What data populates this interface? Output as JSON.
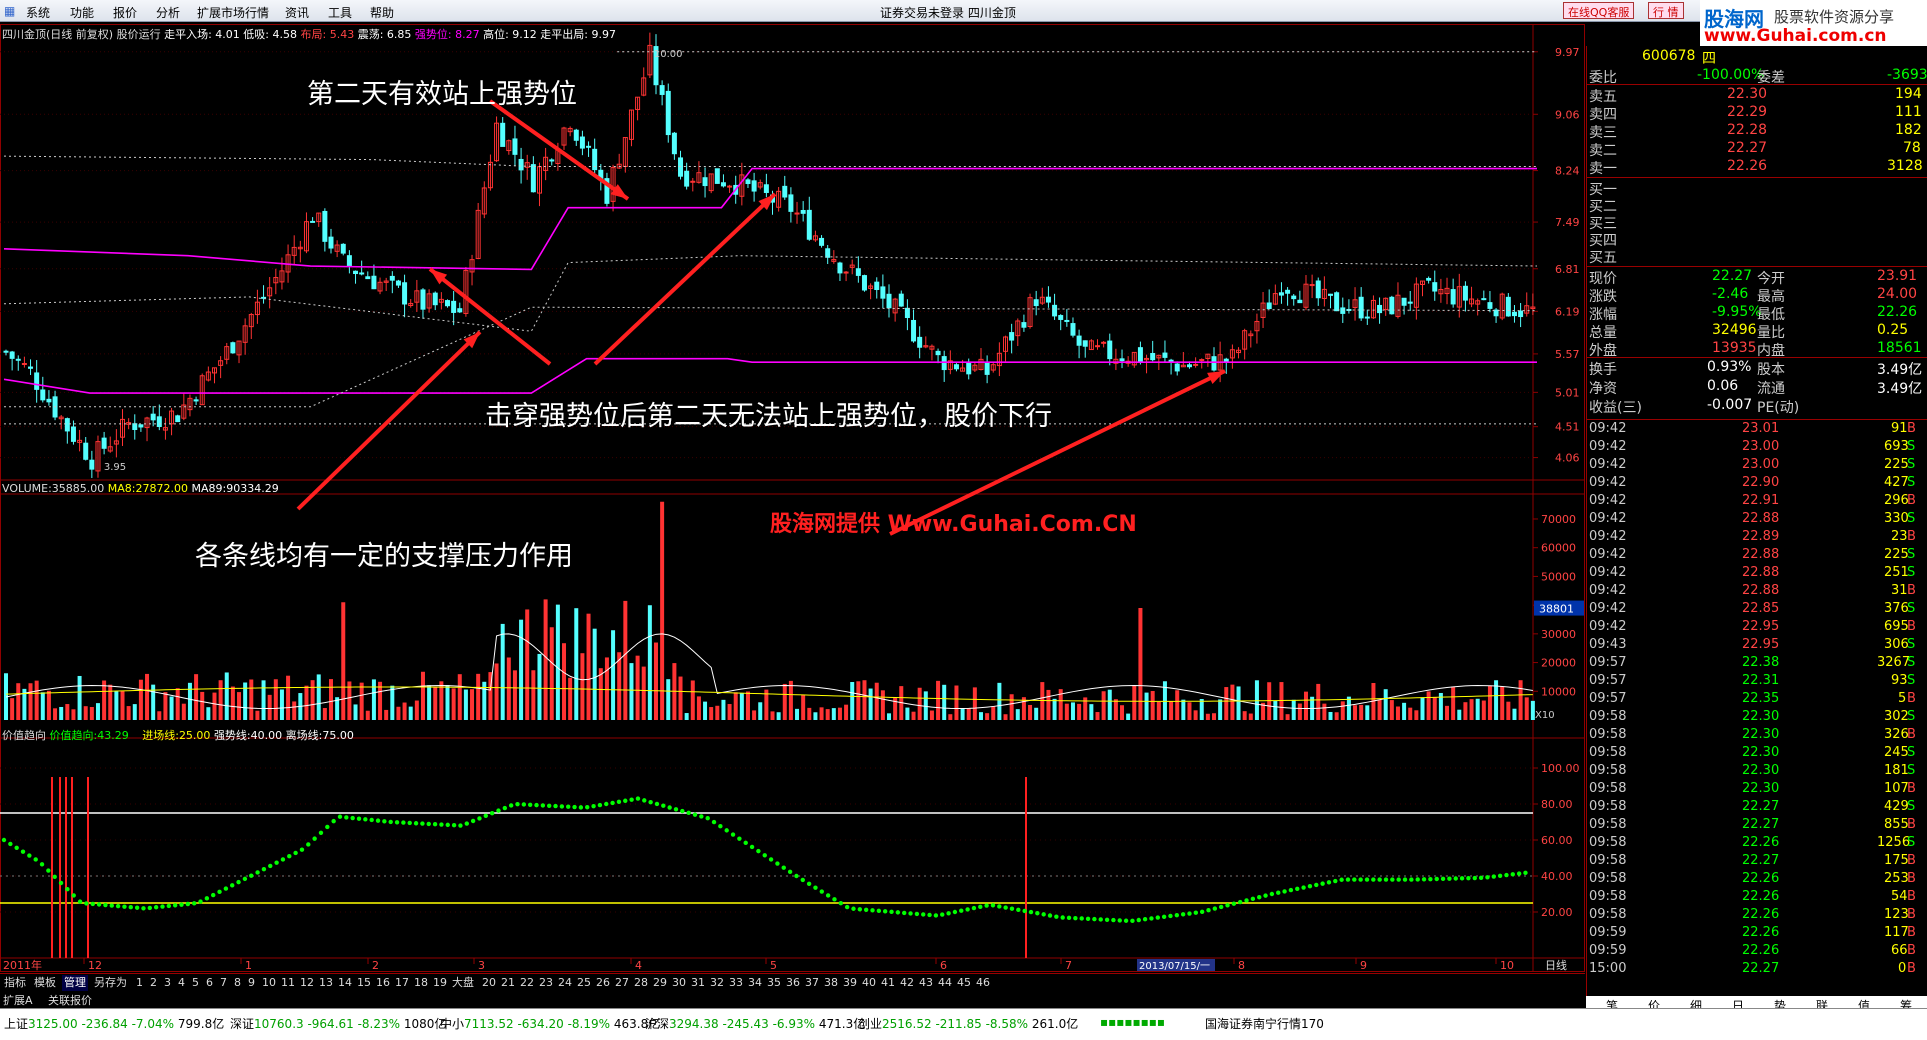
{
  "window": {
    "title": "证券交易未登录   四川金顶",
    "menu": [
      "系统",
      "功能",
      "报价",
      "分析",
      "扩展市场行情",
      "资讯",
      "工具",
      "帮助"
    ],
    "qq_service": "在线QQ客服",
    "market_btn": "行 情",
    "win_buttons": [
      "_",
      "□",
      "×"
    ]
  },
  "logo": {
    "line1_a": "股海网",
    "line1_b": "股票软件资源分享",
    "line2": "www.Guhai.com.cn"
  },
  "chart": {
    "header": {
      "title": "四川金顶(日线 前复权)",
      "indicator": "股价运行",
      "items": [
        {
          "label": "走平入场:",
          "value": "4.01",
          "color": "#ffffff"
        },
        {
          "label": "低吸:",
          "value": "4.58",
          "color": "#ffffff"
        },
        {
          "label": "布局:",
          "value": "5.43",
          "color": "#ff4444"
        },
        {
          "label": "震荡:",
          "value": "6.85",
          "color": "#ffffff"
        },
        {
          "label": "强势位:",
          "value": "8.27",
          "color": "#ff00ff"
        },
        {
          "label": "高位:",
          "value": "9.12",
          "color": "#ffffff"
        },
        {
          "label": "走平出局:",
          "value": "9.97",
          "color": "#ffffff"
        }
      ]
    },
    "price_axis": [
      "9.97",
      "9.06",
      "8.24",
      "7.49",
      "6.81",
      "6.19",
      "5.57",
      "5.01",
      "4.51",
      "4.06"
    ],
    "max_label": "10.00",
    "min_label": "3.95",
    "annotations": {
      "a1": "第二天有效站上强势位",
      "a2": "击穿强势位后第二天无法站上强势位，股价下行",
      "a3": "各条线均有一定的支撑压力作用",
      "watermark": "股海网提供 Www.Guhai.Com.CN"
    },
    "volume": {
      "header": {
        "label": "VOLUME:",
        "value": "35885.00",
        "ma8_label": "MA8:",
        "ma8": "27872.00",
        "ma89_label": "MA89:",
        "ma89": "90334.29"
      },
      "axis": [
        "70000",
        "60000",
        "50000",
        "40000",
        "30000",
        "20000",
        "10000"
      ],
      "current_tag": "38801",
      "unit": "X10"
    },
    "indicator": {
      "header": {
        "name": "价值趋向",
        "l1": "价值趋向:",
        "v1": "43.29",
        "l2": "进场线:",
        "v2": "25.00",
        "l3": "强势线:",
        "v3": "40.00",
        "l4": "离场线:",
        "v4": "75.00"
      },
      "axis": [
        "100.00",
        "80.00",
        "60.00",
        "40.00",
        "20.00"
      ]
    },
    "time_axis": {
      "start": "2011年",
      "ticks": [
        "12",
        "1",
        "2",
        "3",
        "4",
        "5",
        "6",
        "7",
        "8",
        "9",
        "10"
      ],
      "cursor_date": "2013/07/15/一",
      "period": "日线"
    }
  },
  "tabbar": {
    "tabs": [
      "指标",
      "模板",
      "管理",
      "另存为",
      "1",
      "2",
      "3",
      "4",
      "5",
      "6",
      "7",
      "8",
      "9",
      "10",
      "11",
      "12",
      "13",
      "14",
      "15",
      "16",
      "17",
      "18",
      "19",
      "大盘",
      "20",
      "21",
      "22",
      "23",
      "24",
      "25",
      "26",
      "27",
      "28",
      "29",
      "30",
      "31",
      "32",
      "33",
      "34",
      "35",
      "36",
      "37",
      "38",
      "39",
      "40",
      "41",
      "42",
      "43",
      "44",
      "45",
      "46"
    ],
    "tabs2": [
      "扩展A",
      "关联报价"
    ]
  },
  "panel": {
    "code": "600678",
    "name_part": "四",
    "weibi": {
      "label": "委比",
      "value": "-100.00%",
      "label2": "委差",
      "value2": "-3693"
    },
    "asks": [
      {
        "label": "卖五",
        "price": "22.30",
        "vol": "194"
      },
      {
        "label": "卖四",
        "price": "22.29",
        "vol": "111"
      },
      {
        "label": "卖三",
        "price": "22.28",
        "vol": "182"
      },
      {
        "label": "卖二",
        "price": "22.27",
        "vol": "78"
      },
      {
        "label": "卖一",
        "price": "22.26",
        "vol": "3128"
      }
    ],
    "bids": [
      {
        "label": "买一",
        "price": "",
        "vol": ""
      },
      {
        "label": "买二",
        "price": "",
        "vol": ""
      },
      {
        "label": "买三",
        "price": "",
        "vol": ""
      },
      {
        "label": "买四",
        "price": "",
        "vol": ""
      },
      {
        "label": "买五",
        "price": "",
        "vol": ""
      }
    ],
    "quote": [
      {
        "l1": "现价",
        "v1": "22.27",
        "c1": "#00ff00",
        "l2": "今开",
        "v2": "23.91",
        "c2": "#ff4444"
      },
      {
        "l1": "涨跌",
        "v1": "-2.46",
        "c1": "#00ff00",
        "l2": "最高",
        "v2": "24.00",
        "c2": "#ff4444"
      },
      {
        "l1": "涨幅",
        "v1": "-9.95%",
        "c1": "#00ff00",
        "l2": "最低",
        "v2": "22.26",
        "c2": "#00ff00"
      },
      {
        "l1": "总量",
        "v1": "32496",
        "c1": "#ffff00",
        "l2": "量比",
        "v2": "0.25",
        "c2": "#ffff00"
      },
      {
        "l1": "外盘",
        "v1": "13935",
        "c1": "#ff4444",
        "l2": "内盘",
        "v2": "18561",
        "c2": "#00ff00"
      }
    ],
    "stats": [
      {
        "l1": "换手",
        "v1": "0.93%",
        "l2": "股本",
        "v2": "3.49亿"
      },
      {
        "l1": "净资",
        "v1": "0.06",
        "l2": "流通",
        "v2": "3.49亿"
      },
      {
        "l1": "收益(三)",
        "v1": "-0.007",
        "l2": "PE(动)",
        "v2": ""
      }
    ],
    "ticks": [
      {
        "t": "09:42",
        "p": "23.01",
        "v": "91",
        "d": "B"
      },
      {
        "t": "09:42",
        "p": "23.00",
        "v": "693",
        "d": "S"
      },
      {
        "t": "09:42",
        "p": "23.00",
        "v": "225",
        "d": "S"
      },
      {
        "t": "09:42",
        "p": "22.90",
        "v": "427",
        "d": "S"
      },
      {
        "t": "09:42",
        "p": "22.91",
        "v": "296",
        "d": "B"
      },
      {
        "t": "09:42",
        "p": "22.88",
        "v": "330",
        "d": "S"
      },
      {
        "t": "09:42",
        "p": "22.89",
        "v": "23",
        "d": "B"
      },
      {
        "t": "09:42",
        "p": "22.88",
        "v": "225",
        "d": "S"
      },
      {
        "t": "09:42",
        "p": "22.88",
        "v": "251",
        "d": "S"
      },
      {
        "t": "09:42",
        "p": "22.88",
        "v": "31",
        "d": "B"
      },
      {
        "t": "09:42",
        "p": "22.85",
        "v": "376",
        "d": "S"
      },
      {
        "t": "09:42",
        "p": "22.95",
        "v": "695",
        "d": "B"
      },
      {
        "t": "09:43",
        "p": "22.95",
        "v": "306",
        "d": "S"
      },
      {
        "t": "09:57",
        "p": "22.38",
        "v": "3267",
        "d": "S"
      },
      {
        "t": "09:57",
        "p": "22.31",
        "v": "93",
        "d": "S"
      },
      {
        "t": "09:57",
        "p": "22.35",
        "v": "5",
        "d": "B"
      },
      {
        "t": "09:58",
        "p": "22.30",
        "v": "302",
        "d": "S"
      },
      {
        "t": "09:58",
        "p": "22.30",
        "v": "326",
        "d": "B"
      },
      {
        "t": "09:58",
        "p": "22.30",
        "v": "245",
        "d": "S"
      },
      {
        "t": "09:58",
        "p": "22.30",
        "v": "181",
        "d": "S"
      },
      {
        "t": "09:58",
        "p": "22.30",
        "v": "107",
        "d": "B"
      },
      {
        "t": "09:58",
        "p": "22.27",
        "v": "429",
        "d": "S"
      },
      {
        "t": "09:58",
        "p": "22.27",
        "v": "855",
        "d": "B"
      },
      {
        "t": "09:58",
        "p": "22.26",
        "v": "1256",
        "d": "S"
      },
      {
        "t": "09:58",
        "p": "22.27",
        "v": "175",
        "d": "B"
      },
      {
        "t": "09:58",
        "p": "22.26",
        "v": "253",
        "d": "B"
      },
      {
        "t": "09:58",
        "p": "22.26",
        "v": "54",
        "d": "B"
      },
      {
        "t": "09:58",
        "p": "22.26",
        "v": "123",
        "d": "B"
      },
      {
        "t": "09:59",
        "p": "22.26",
        "v": "117",
        "d": "B"
      },
      {
        "t": "09:59",
        "p": "22.26",
        "v": "66",
        "d": "B"
      },
      {
        "t": "15:00",
        "p": "22.27",
        "v": "0",
        "d": "B"
      }
    ],
    "tabs": [
      "笔",
      "价",
      "细",
      "日",
      "势",
      "联",
      "值",
      "筹"
    ]
  },
  "status": {
    "items": [
      {
        "name": "上证",
        "val": "3125.00",
        "chg": "-236.84",
        "pct": "-7.04%",
        "amt": "799.8亿"
      },
      {
        "name": "深证",
        "val": "10760.3",
        "chg": "-964.61",
        "pct": "-8.23%",
        "amt": "1080亿"
      },
      {
        "name": "中小",
        "val": "7113.52",
        "chg": "-634.20",
        "pct": "-8.19%",
        "amt": "463.8亿"
      },
      {
        "name": "沪深",
        "val": "3294.38",
        "chg": "-245.43",
        "pct": "-6.93%",
        "amt": "471.3亿"
      },
      {
        "name": "创业",
        "val": "2516.52",
        "chg": "-211.85",
        "pct": "-8.58%",
        "amt": "261.0亿"
      }
    ],
    "server": "国海证券南宁行情170"
  },
  "colors": {
    "up": "#ff3333",
    "down": "#54ffff",
    "magenta": "#ff00ff",
    "green": "#00ff00",
    "yellow": "#ffff00",
    "grid": "#900000"
  }
}
